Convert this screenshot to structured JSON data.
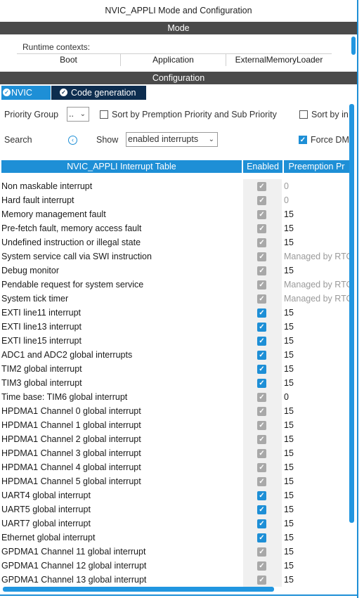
{
  "window": {
    "title": "NVIC_APPLI Mode and Configuration"
  },
  "sections": {
    "mode": "Mode",
    "configuration": "Configuration"
  },
  "mode": {
    "runtime_contexts_label": "Runtime contexts:",
    "contexts": [
      "Boot",
      "Application",
      "ExternalMemoryLoader"
    ]
  },
  "tabs": [
    {
      "label": "NVIC",
      "active": true
    },
    {
      "label": "Code generation",
      "active": false
    }
  ],
  "controls": {
    "priority_group_label": "Priority Group",
    "priority_group_value": "..",
    "sort_premption_label": "Sort by Premption Priority and Sub Priority",
    "sort_by_label": "Sort by in",
    "search_label": "Search",
    "show_label": "Show",
    "show_value": "enabled interrupts",
    "force_label": "Force DM",
    "force_checked": true
  },
  "table": {
    "headers": [
      "NVIC_APPLI Interrupt Table",
      "Enabled",
      "Preemption Pr"
    ],
    "rows": [
      {
        "name": "Non maskable interrupt",
        "enabled": true,
        "locked": true,
        "priority": "0",
        "dim": true
      },
      {
        "name": "Hard fault interrupt",
        "enabled": true,
        "locked": true,
        "priority": "0",
        "dim": true
      },
      {
        "name": "Memory management fault",
        "enabled": true,
        "locked": true,
        "priority": "15",
        "dim": false
      },
      {
        "name": "Pre-fetch fault, memory access fault",
        "enabled": true,
        "locked": true,
        "priority": "15",
        "dim": false
      },
      {
        "name": "Undefined instruction or illegal state",
        "enabled": true,
        "locked": true,
        "priority": "15",
        "dim": false
      },
      {
        "name": "System service call via SWI instruction",
        "enabled": true,
        "locked": true,
        "priority": "Managed by RTO",
        "dim": true
      },
      {
        "name": "Debug monitor",
        "enabled": true,
        "locked": true,
        "priority": "15",
        "dim": false
      },
      {
        "name": "Pendable request for system service",
        "enabled": true,
        "locked": true,
        "priority": "Managed by RTO",
        "dim": true
      },
      {
        "name": "System tick timer",
        "enabled": true,
        "locked": true,
        "priority": "Managed by RTO",
        "dim": true
      },
      {
        "name": "EXTI line11 interrupt",
        "enabled": true,
        "locked": false,
        "priority": "15",
        "dim": false
      },
      {
        "name": "EXTI line13 interrupt",
        "enabled": true,
        "locked": false,
        "priority": "15",
        "dim": false
      },
      {
        "name": "EXTI line15 interrupt",
        "enabled": true,
        "locked": false,
        "priority": "15",
        "dim": false
      },
      {
        "name": "ADC1 and ADC2 global interrupts",
        "enabled": true,
        "locked": false,
        "priority": "15",
        "dim": false
      },
      {
        "name": "TIM2 global interrupt",
        "enabled": true,
        "locked": false,
        "priority": "15",
        "dim": false
      },
      {
        "name": "TIM3 global interrupt",
        "enabled": true,
        "locked": false,
        "priority": "15",
        "dim": false
      },
      {
        "name": "Time base: TIM6 global interrupt",
        "enabled": true,
        "locked": true,
        "priority": "0",
        "dim": false
      },
      {
        "name": "HPDMA1 Channel 0 global interrupt",
        "enabled": true,
        "locked": true,
        "priority": "15",
        "dim": false
      },
      {
        "name": "HPDMA1 Channel 1 global interrupt",
        "enabled": true,
        "locked": true,
        "priority": "15",
        "dim": false
      },
      {
        "name": "HPDMA1 Channel 2 global interrupt",
        "enabled": true,
        "locked": true,
        "priority": "15",
        "dim": false
      },
      {
        "name": "HPDMA1 Channel 3 global interrupt",
        "enabled": true,
        "locked": true,
        "priority": "15",
        "dim": false
      },
      {
        "name": "HPDMA1 Channel 4 global interrupt",
        "enabled": true,
        "locked": true,
        "priority": "15",
        "dim": false
      },
      {
        "name": "HPDMA1 Channel 5 global interrupt",
        "enabled": true,
        "locked": true,
        "priority": "15",
        "dim": false
      },
      {
        "name": "UART4 global interrupt",
        "enabled": true,
        "locked": false,
        "priority": "15",
        "dim": false
      },
      {
        "name": "UART5 global interrupt",
        "enabled": true,
        "locked": false,
        "priority": "15",
        "dim": false
      },
      {
        "name": "UART7 global interrupt",
        "enabled": true,
        "locked": false,
        "priority": "15",
        "dim": false
      },
      {
        "name": "Ethernet global interrupt",
        "enabled": true,
        "locked": false,
        "priority": "15",
        "dim": false
      },
      {
        "name": "GPDMA1 Channel 11 global interrupt",
        "enabled": true,
        "locked": true,
        "priority": "15",
        "dim": false
      },
      {
        "name": "GPDMA1 Channel 12 global interrupt",
        "enabled": true,
        "locked": true,
        "priority": "15",
        "dim": false
      },
      {
        "name": "GPDMA1 Channel 13 global interrupt",
        "enabled": true,
        "locked": true,
        "priority": "15",
        "dim": false
      }
    ]
  },
  "colors": {
    "accent": "#1e8fd6",
    "dark_tab": "#0d2d4f",
    "section_bar": "#4a4a4a",
    "locked_check": "#a8a8a8"
  }
}
